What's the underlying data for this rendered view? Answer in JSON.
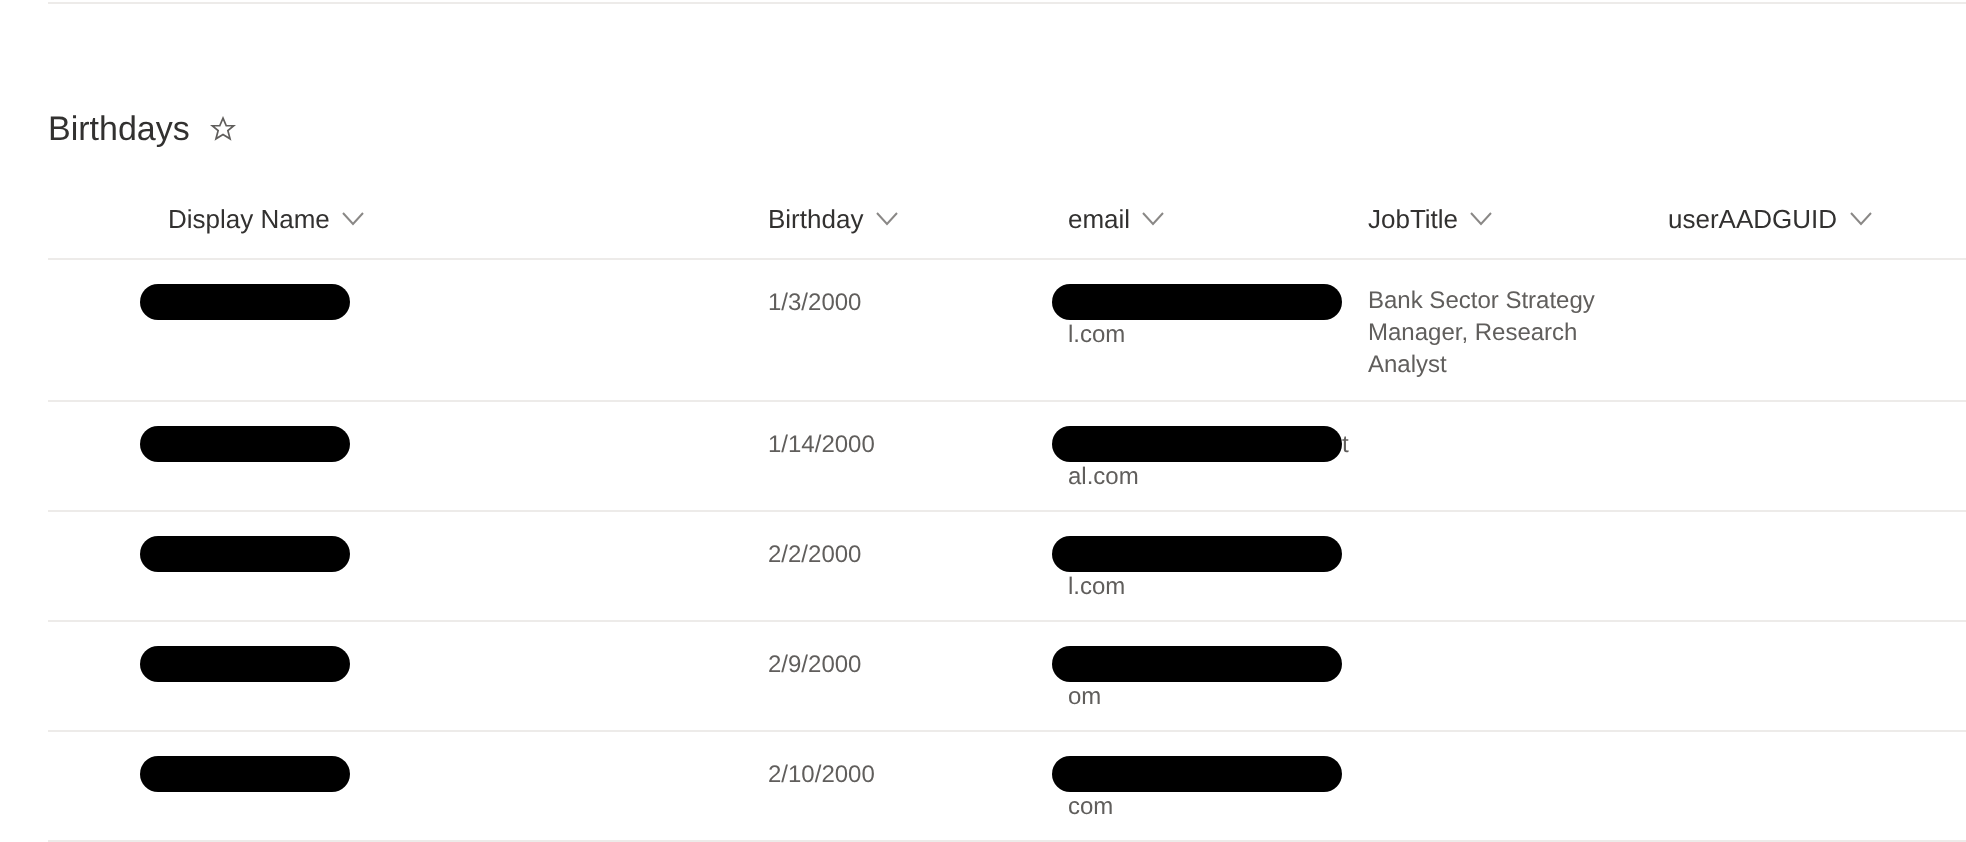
{
  "list": {
    "title": "Birthdays",
    "favorite": false
  },
  "table": {
    "columns": [
      "Display Name",
      "Birthday",
      "email",
      "JobTitle",
      "userAADGUID"
    ],
    "rows": [
      {
        "display_name": {
          "redacted": true
        },
        "birthday": "1/3/2000",
        "email": {
          "redacted": true,
          "second_line": "l.com"
        },
        "job_title": "Bank Sector Strategy Manager, Research Analyst"
      },
      {
        "display_name": {
          "redacted": true
        },
        "birthday": "1/14/2000",
        "email": {
          "redacted": true,
          "tail": "t",
          "second_line": "al.com"
        }
      },
      {
        "display_name": {
          "redacted": true
        },
        "birthday": "2/2/2000",
        "email": {
          "redacted": true,
          "second_line": "l.com"
        }
      },
      {
        "display_name": {
          "redacted": true
        },
        "birthday": "2/9/2000",
        "email": {
          "redacted": true,
          "second_line": "om"
        }
      },
      {
        "display_name": {
          "redacted": true
        },
        "birthday": "2/10/2000",
        "email": {
          "redacted": true,
          "second_line": "com"
        }
      }
    ]
  }
}
